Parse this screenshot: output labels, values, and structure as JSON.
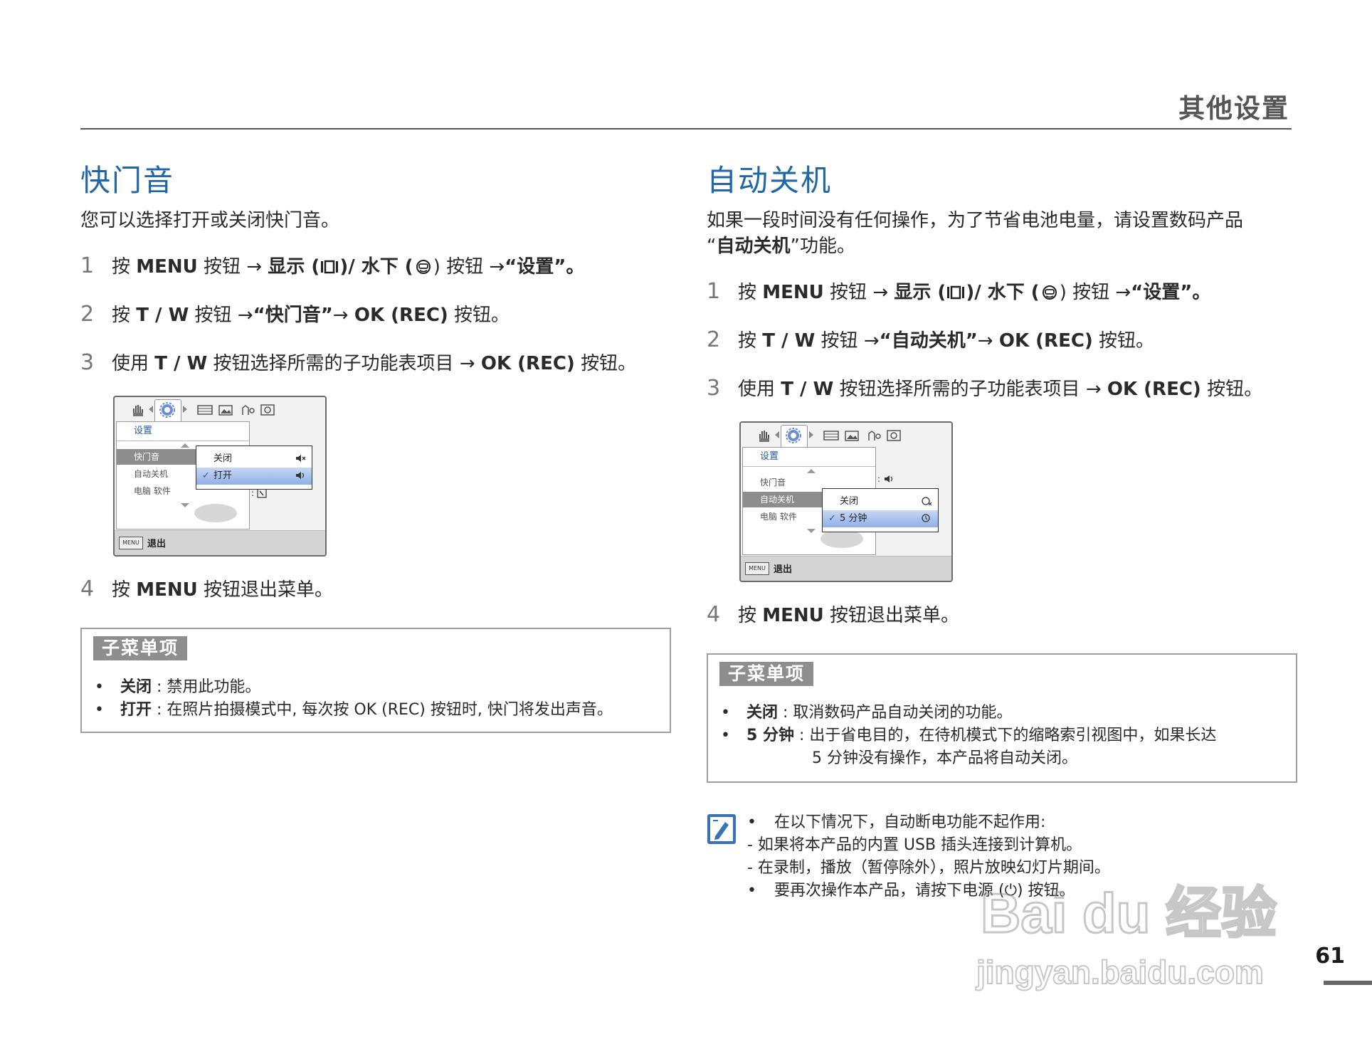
{
  "header": {
    "title": "其他设置"
  },
  "left": {
    "title": "快门音",
    "intro": "您可以选择打开或关闭快门音。",
    "steps": [
      {
        "num": "1",
        "a": "按 ",
        "b": "MENU",
        "c": " 按钮 ",
        "d": "→ ",
        "e": "显示 (",
        "f": ")/ 水下 (",
        "g": ") 按钮 ",
        "h": "→",
        "i": "“设置”。"
      },
      {
        "num": "2",
        "a": "按 ",
        "b": "T / W",
        "c": " 按钮 ",
        "d": "→",
        "e": "“快门音”",
        "f": "→ ",
        "g": "OK (REC)",
        "h": " 按钮。"
      },
      {
        "num": "3",
        "a": "使用 ",
        "b": "T / W",
        "c": " 按钮选择所需的子功能表项目 ",
        "d": "→ ",
        "e": "OK (REC)",
        "f": " 按钮。"
      },
      {
        "num": "4",
        "a": "按 ",
        "b": "MENU",
        "c": " 按钮退出菜单。"
      }
    ],
    "screen": {
      "menu_title": "设置",
      "items": [
        "快门音",
        "自动关机",
        "电脑 软件"
      ],
      "options": [
        "关闭",
        "打开"
      ],
      "footer_btn": "MENU",
      "footer_exit": "退出"
    },
    "submenu": {
      "tag": "子菜单项",
      "items": [
        {
          "bullet": "•",
          "label": "关闭",
          "sep": " :  ",
          "text": "禁用此功能。"
        },
        {
          "bullet": "•",
          "label": "打开",
          "sep": " :  ",
          "text": "在照片拍摄模式中, 每次按 OK (REC) 按钮时, 快门将发出声音。"
        }
      ]
    }
  },
  "right": {
    "title": "自动关机",
    "intro_1": "如果一段时间没有任何操作，为了节省电池电量，请设置数码产品",
    "intro_2a": "“",
    "intro_2b": "自动关机",
    "intro_2c": "”功能。",
    "steps": [
      {
        "num": "1",
        "a": "按 ",
        "b": "MENU",
        "c": " 按钮 ",
        "d": "→ ",
        "e": "显示 (",
        "f": ")/ 水下 (",
        "g": ") 按钮 ",
        "h": "→",
        "i": "“设置”。"
      },
      {
        "num": "2",
        "a": "按 ",
        "b": "T / W",
        "c": " 按钮 ",
        "d": "→",
        "e": "“自动关机”",
        "f": "→ ",
        "g": "OK (REC)",
        "h": " 按钮。"
      },
      {
        "num": "3",
        "a": "使用 ",
        "b": "T / W",
        "c": " 按钮选择所需的子功能表项目 ",
        "d": "→ ",
        "e": "OK (REC)",
        "f": " 按钮。"
      },
      {
        "num": "4",
        "a": "按 ",
        "b": "MENU",
        "c": " 按钮退出菜单。"
      }
    ],
    "screen": {
      "menu_title": "设置",
      "items": [
        "快门音",
        "自动关机",
        "电脑 软件"
      ],
      "options": [
        "关闭",
        "5 分钟"
      ],
      "footer_btn": "MENU",
      "footer_exit": "退出"
    },
    "submenu": {
      "tag": "子菜单项",
      "items": [
        {
          "bullet": "•",
          "label": "关闭",
          "sep": " :  ",
          "text": "取消数码产品自动关闭的功能。"
        },
        {
          "bullet": "•",
          "label": "5 分钟",
          "sep": " :  ",
          "text": "出于省电目的，在待机模式下的缩略索引视图中，如果长达"
        }
      ],
      "cont": "5  分钟没有操作，本产品将自动关闭。"
    },
    "note": {
      "icon": "note-pencil-icon",
      "lines": [
        {
          "bullet": "•",
          "text": "在以下情况下，自动断电功能不起作用:"
        },
        {
          "bullet": "",
          "text": "- 如果将本产品的内置 USB 插头连接到计算机。"
        },
        {
          "bullet": "",
          "text": "- 在录制，播放（暂停除外），照片放映幻灯片期间。"
        },
        {
          "bullet": "•",
          "text": "要再次操作本产品，请按下电源 (⏻) 按钮。"
        }
      ]
    }
  },
  "page_number": "61",
  "watermark": {
    "line1": "Bai du 经验",
    "line2": "jingyan.baidu.com"
  },
  "colors": {
    "title_blue": "#1f67a8",
    "gray_tag": "#8e8e8e",
    "rule": "#555555"
  }
}
